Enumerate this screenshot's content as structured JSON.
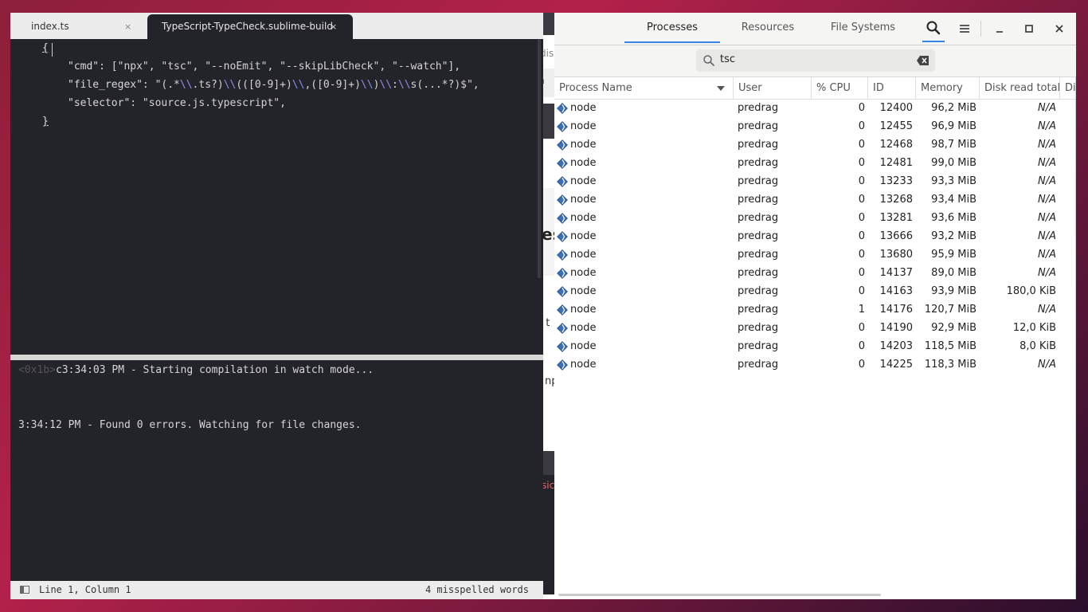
{
  "sublime": {
    "tabs": [
      {
        "label": "index.ts",
        "close": "×"
      },
      {
        "label": "TypeScript-TypeCheck.sublime-build",
        "close": "×"
      }
    ],
    "code": {
      "line1": "{",
      "cmd_key": "\"cmd\"",
      "cmd_value": ": [\"npx\", \"tsc\", \"--noEmit\", \"--skipLibCheck\", \"--watch\"],",
      "regex_key": "\"file_regex\"",
      "regex_prefix": ": \"(.*",
      "regex_esc1": "\\\\",
      "regex_mid1": ".ts?)",
      "regex_esc2": "\\\\",
      "regex_mid2": "(([0-9]+)",
      "regex_esc3": "\\\\",
      "regex_mid3": ",([0-9]+)",
      "regex_esc4": "\\\\",
      "regex_mid4": ")",
      "regex_esc5": "\\\\",
      "regex_mid5": ":",
      "regex_esc6": "\\\\",
      "regex_tail": "s(...*?)$\",",
      "selector_key": "\"selector\"",
      "selector_value": ": \"source.js.typescript\",",
      "line5": "}"
    },
    "output": {
      "esc_prefix": "<0x1b>",
      "line1": "c3:34:03 PM - Starting compilation in watch mode...",
      "line2": "3:34:12 PM - Found 0 errors. Watching for file changes."
    },
    "status": {
      "position": "Line 1, Column 1",
      "spelling": "4 misspelled words"
    }
  },
  "background": {
    "fragments": [
      "dis",
      "n",
      "es",
      "t t",
      "np",
      "sic"
    ]
  },
  "sysmon": {
    "tabs": [
      "Processes",
      "Resources",
      "File Systems"
    ],
    "search": {
      "value": "tsc"
    },
    "columns": [
      "Process Name",
      "User",
      "% CPU",
      "ID",
      "Memory",
      "Disk read total",
      "Di"
    ],
    "rows": [
      {
        "name": "node",
        "user": "predrag",
        "cpu": "0",
        "id": "12400",
        "memory": "96,2 MiB",
        "disk": "N/A"
      },
      {
        "name": "node",
        "user": "predrag",
        "cpu": "0",
        "id": "12455",
        "memory": "96,9 MiB",
        "disk": "N/A"
      },
      {
        "name": "node",
        "user": "predrag",
        "cpu": "0",
        "id": "12468",
        "memory": "98,7 MiB",
        "disk": "N/A"
      },
      {
        "name": "node",
        "user": "predrag",
        "cpu": "0",
        "id": "12481",
        "memory": "99,0 MiB",
        "disk": "N/A"
      },
      {
        "name": "node",
        "user": "predrag",
        "cpu": "0",
        "id": "13233",
        "memory": "93,3 MiB",
        "disk": "N/A"
      },
      {
        "name": "node",
        "user": "predrag",
        "cpu": "0",
        "id": "13268",
        "memory": "93,4 MiB",
        "disk": "N/A"
      },
      {
        "name": "node",
        "user": "predrag",
        "cpu": "0",
        "id": "13281",
        "memory": "93,6 MiB",
        "disk": "N/A"
      },
      {
        "name": "node",
        "user": "predrag",
        "cpu": "0",
        "id": "13666",
        "memory": "93,2 MiB",
        "disk": "N/A"
      },
      {
        "name": "node",
        "user": "predrag",
        "cpu": "0",
        "id": "13680",
        "memory": "95,9 MiB",
        "disk": "N/A"
      },
      {
        "name": "node",
        "user": "predrag",
        "cpu": "0",
        "id": "14137",
        "memory": "89,0 MiB",
        "disk": "N/A"
      },
      {
        "name": "node",
        "user": "predrag",
        "cpu": "0",
        "id": "14163",
        "memory": "93,9 MiB",
        "disk": "180,0 KiB"
      },
      {
        "name": "node",
        "user": "predrag",
        "cpu": "1",
        "id": "14176",
        "memory": "120,7 MiB",
        "disk": "N/A"
      },
      {
        "name": "node",
        "user": "predrag",
        "cpu": "0",
        "id": "14190",
        "memory": "92,9 MiB",
        "disk": "12,0 KiB"
      },
      {
        "name": "node",
        "user": "predrag",
        "cpu": "0",
        "id": "14203",
        "memory": "118,5 MiB",
        "disk": "8,0 KiB"
      },
      {
        "name": "node",
        "user": "predrag",
        "cpu": "0",
        "id": "14225",
        "memory": "118,3 MiB",
        "disk": "N/A"
      }
    ]
  },
  "colors": {
    "accent": "#3584e4",
    "editor_bg": "#23232a"
  }
}
